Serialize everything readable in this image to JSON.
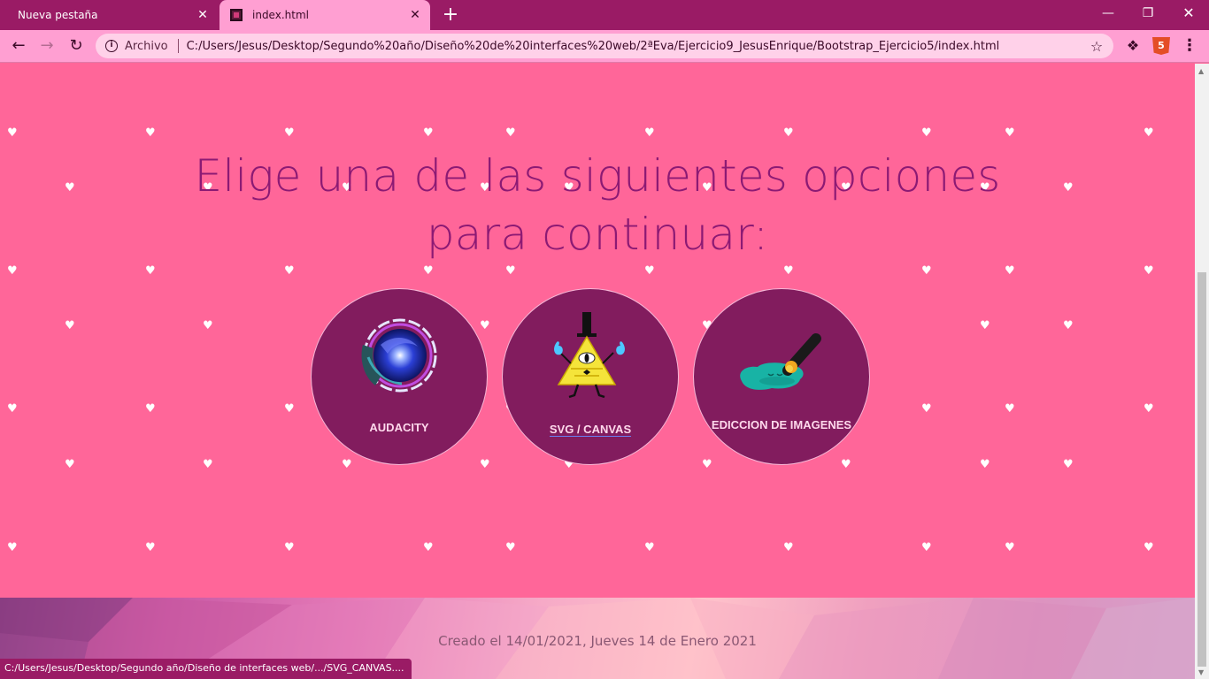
{
  "browser": {
    "tabs": [
      {
        "title": "Nueva pestaña",
        "active": false
      },
      {
        "title": "index.html",
        "active": true
      }
    ],
    "new_tab_label": "+",
    "omnibox": {
      "site_label": "Archivo",
      "url": "C:/Users/Jesus/Desktop/Segundo%20año/Diseño%20de%20interfaces%20web/2ªEva/Ejercicio9_JesusEnrique/Bootstrap_Ejercicio5/index.html"
    },
    "status_url": "C:/Users/Jesus/Desktop/Segundo año/Diseño de interfaces web/.../SVG_CANVAS....",
    "theme_color": "#9a1b65"
  },
  "page": {
    "heading": "Elige una de las siguientes opciones para continuar:",
    "options": [
      {
        "label": "AUDACITY",
        "icon": "audacity-orb-icon"
      },
      {
        "label": "SVG / CANVAS",
        "icon": "bill-cipher-icon"
      },
      {
        "label": "EDICCION DE IMAGENES",
        "icon": "paint-brush-icon"
      }
    ],
    "footer_text": "Creado el 14/01/2021, Jueves 14 de Enero 2021",
    "colors": {
      "background": "#ff6699",
      "heading": "#8c1a74",
      "circle": "#821c5e"
    }
  }
}
